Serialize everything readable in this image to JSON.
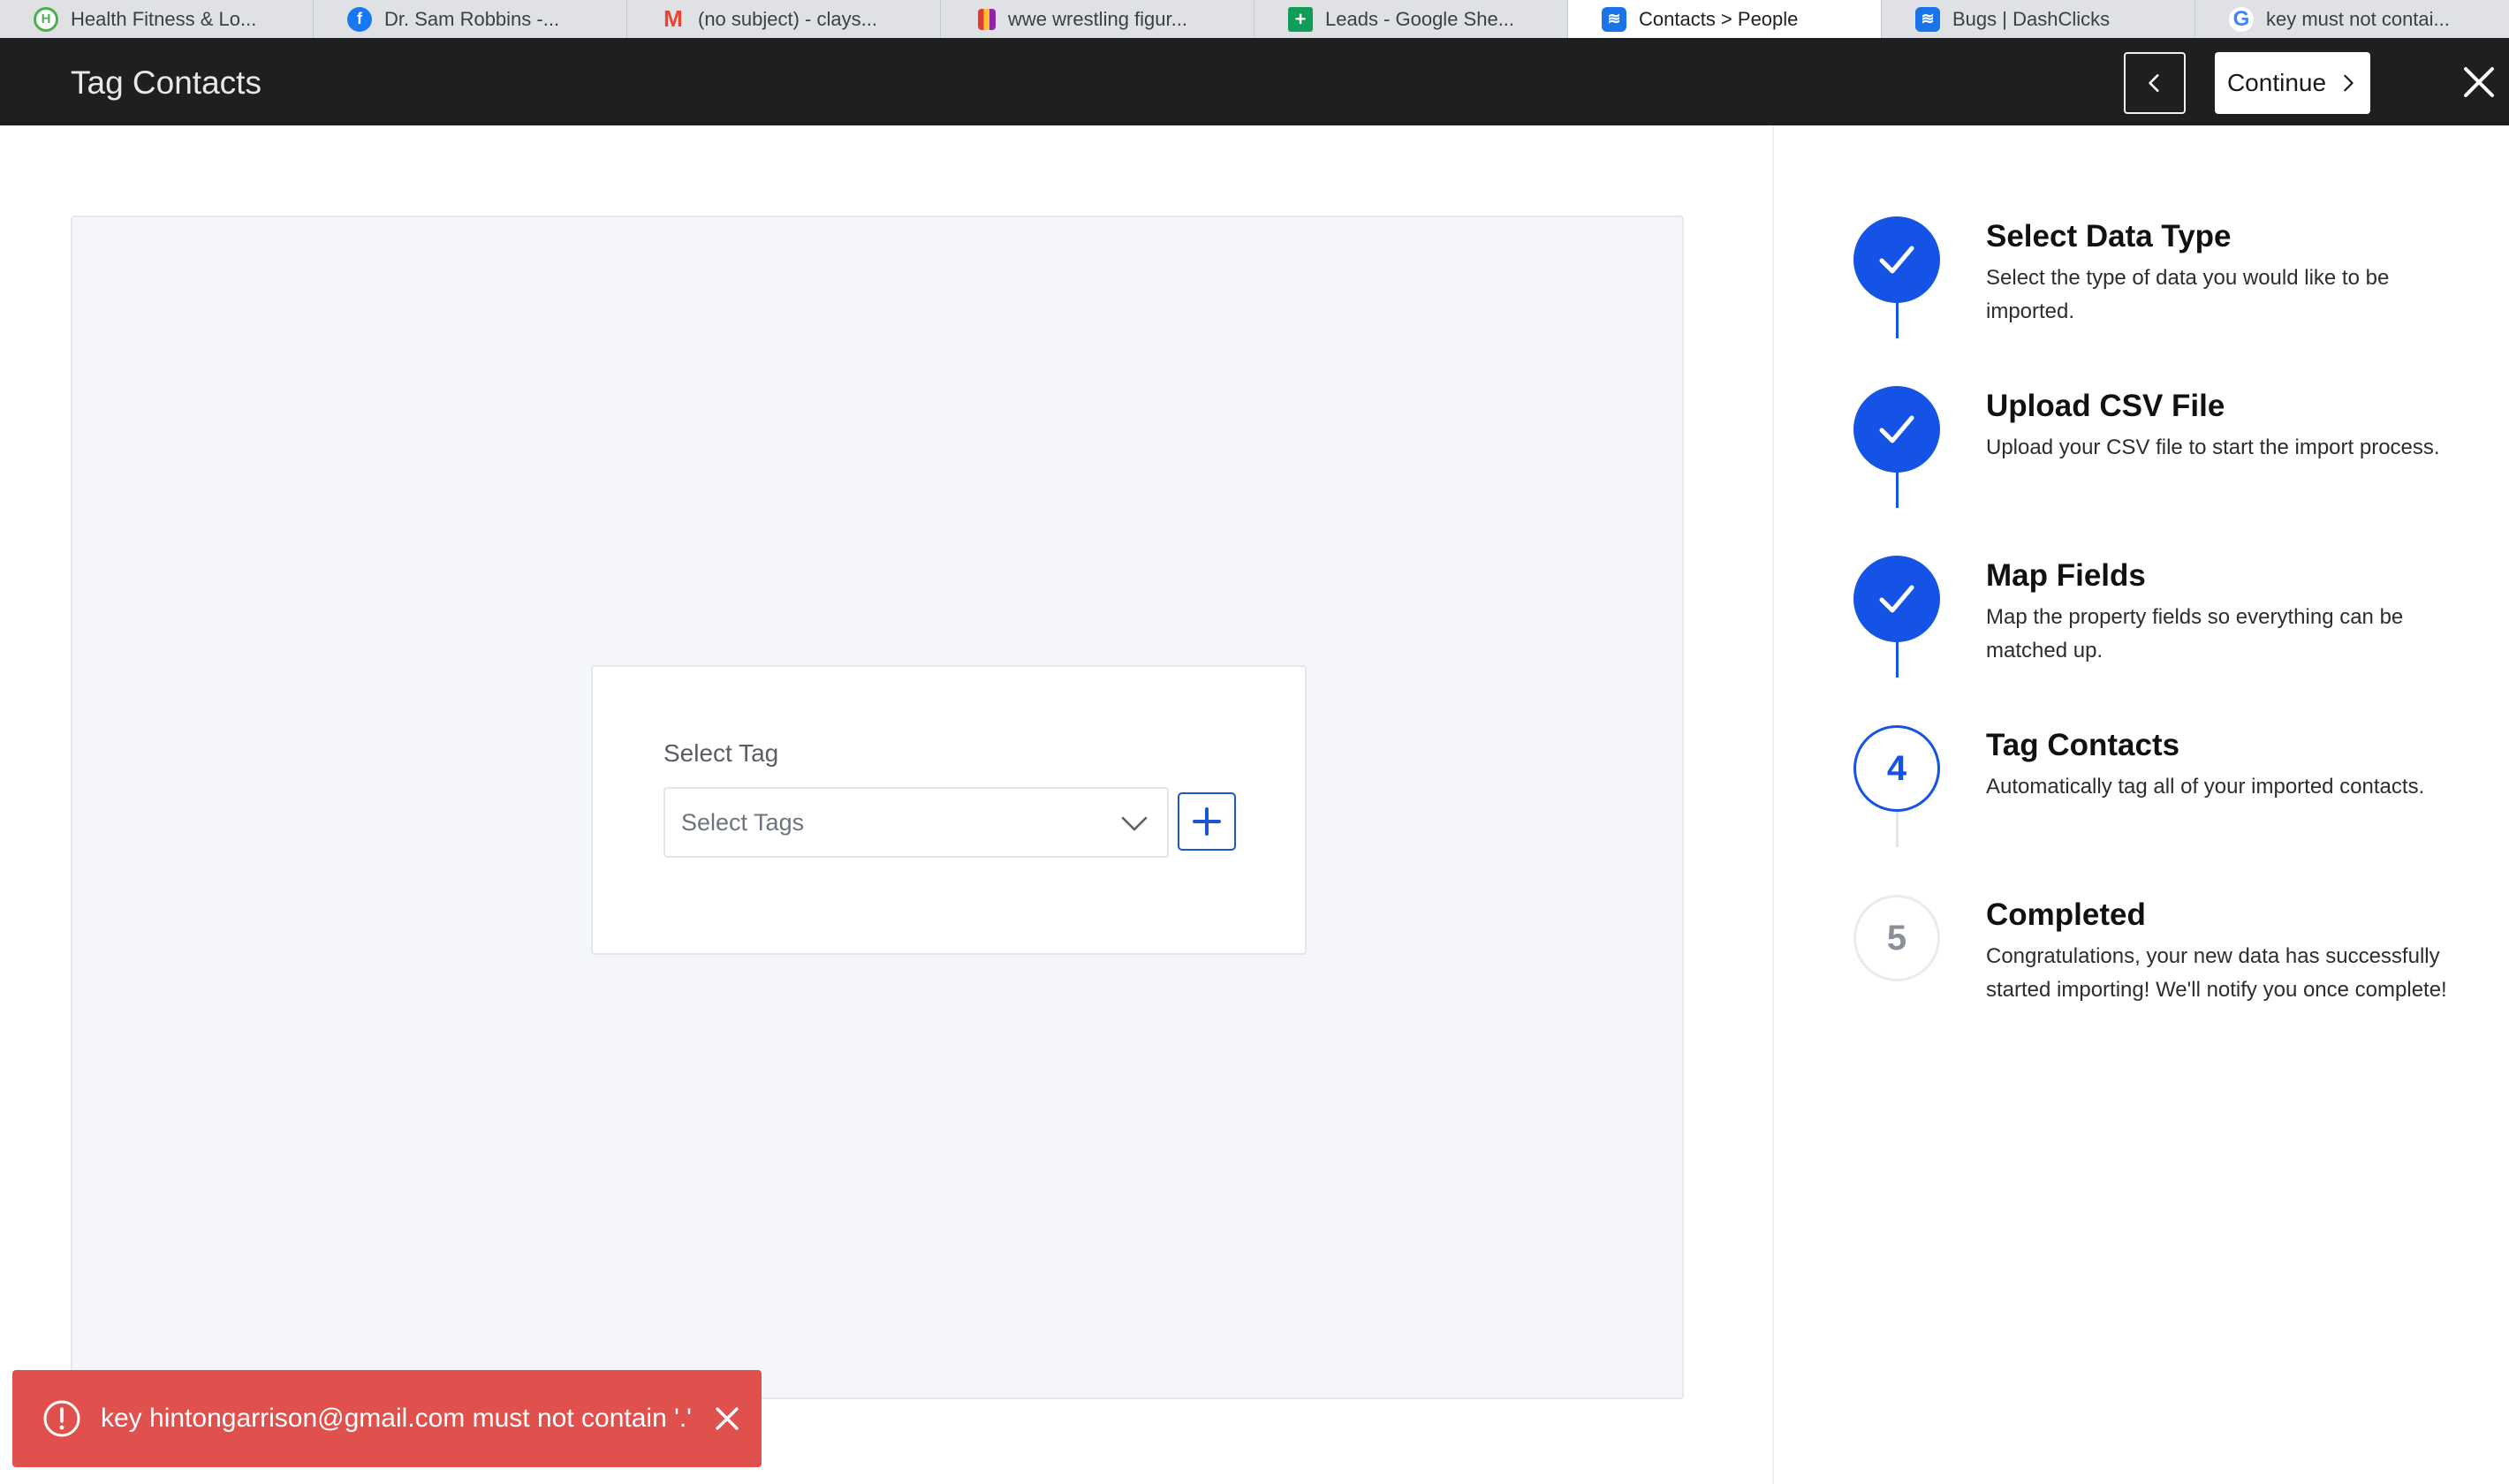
{
  "browser": {
    "tabs": [
      {
        "title": "Health Fitness & Lo...",
        "icon": "health-fitness-favicon-icon",
        "color": "#4caf50",
        "active": false
      },
      {
        "title": "Dr. Sam Robbins -...",
        "icon": "facebook-icon",
        "color": "#1877f2",
        "active": false
      },
      {
        "title": "(no subject) - clays...",
        "icon": "gmail-icon",
        "color": "#ea4335",
        "active": false
      },
      {
        "title": "wwe wrestling figur...",
        "icon": "shopping-bag-icon",
        "color": "#b5651d",
        "active": false
      },
      {
        "title": "Leads - Google She...",
        "icon": "google-sheets-icon",
        "color": "#0f9d58",
        "active": false
      },
      {
        "title": "Contacts > People",
        "icon": "dashclicks-icon",
        "color": "#1a73e8",
        "active": true
      },
      {
        "title": "Bugs | DashClicks",
        "icon": "dashclicks-icon",
        "color": "#1a73e8",
        "active": false
      },
      {
        "title": "key must not contai...",
        "icon": "google-icon",
        "color": "#4285f4",
        "active": false
      }
    ]
  },
  "header": {
    "title": "Tag Contacts",
    "continue_label": "Continue"
  },
  "tag_form": {
    "label": "Select Tag",
    "placeholder": "Select Tags"
  },
  "steps": [
    {
      "number": "1",
      "status": "done",
      "title": "Select Data Type",
      "description": "Select the type of data you would like to be imported."
    },
    {
      "number": "2",
      "status": "done",
      "title": "Upload CSV File",
      "description": "Upload your CSV file to start the import process."
    },
    {
      "number": "3",
      "status": "done",
      "title": "Map Fields",
      "description": "Map the property fields so everything can be matched up."
    },
    {
      "number": "4",
      "status": "current",
      "title": "Tag Contacts",
      "description": "Automatically tag all of your imported contacts."
    },
    {
      "number": "5",
      "status": "todo",
      "title": "Completed",
      "description": "Congratulations, your new data has successfully started importing! We'll notify you once complete!"
    }
  ],
  "toast": {
    "message": "key hintongarrison@gmail.com must not contain '.'",
    "color": "#e0504d"
  },
  "colors": {
    "accent": "#1552e6",
    "header_bg": "#1e1f20",
    "error": "#e0504d"
  }
}
